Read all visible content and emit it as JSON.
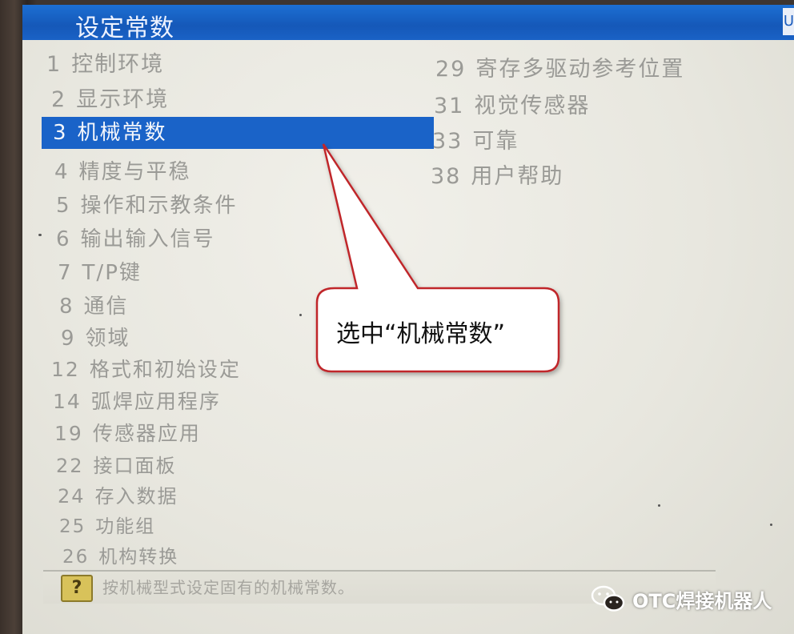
{
  "title_bar": {
    "title": "设定常数",
    "badge": "U"
  },
  "menu": {
    "left": [
      {
        "num": "1",
        "label": "控制环境"
      },
      {
        "num": "2",
        "label": "显示环境"
      },
      {
        "num": "3",
        "label": "机械常数",
        "selected": true
      },
      {
        "num": "4",
        "label": "精度与平稳"
      },
      {
        "num": "5",
        "label": "操作和示教条件"
      },
      {
        "num": "6",
        "label": "输出输入信号"
      },
      {
        "num": "7",
        "label": "T/P键"
      },
      {
        "num": "8",
        "label": "通信"
      },
      {
        "num": "9",
        "label": "领域"
      },
      {
        "num": "12",
        "label": "格式和初始设定"
      },
      {
        "num": "14",
        "label": "弧焊应用程序"
      },
      {
        "num": "19",
        "label": "传感器应用"
      },
      {
        "num": "22",
        "label": "接口面板"
      },
      {
        "num": "24",
        "label": "存入数据"
      },
      {
        "num": "25",
        "label": "功能组"
      },
      {
        "num": "26",
        "label": "机构转换"
      }
    ],
    "right": [
      {
        "num": "29",
        "label": "寄存多驱动参考位置"
      },
      {
        "num": "31",
        "label": "视觉传感器"
      },
      {
        "num": "33",
        "label": "可靠"
      },
      {
        "num": "38",
        "label": "用户帮助"
      }
    ]
  },
  "status_bar": {
    "icon": "help-icon",
    "icon_glyph": "?",
    "text": "按机械型式设定固有的机械常数。"
  },
  "callout": {
    "text": "选中“机械常数”",
    "border_color": "#c0282c"
  },
  "watermark": {
    "icon": "wechat-icon",
    "text": "OTC焊接机器人"
  },
  "colors": {
    "title_bar": "#1a62c6",
    "selection": "#1a63c8",
    "menu_text": "#9a9a96",
    "screen_bg": "#ecebe4"
  }
}
